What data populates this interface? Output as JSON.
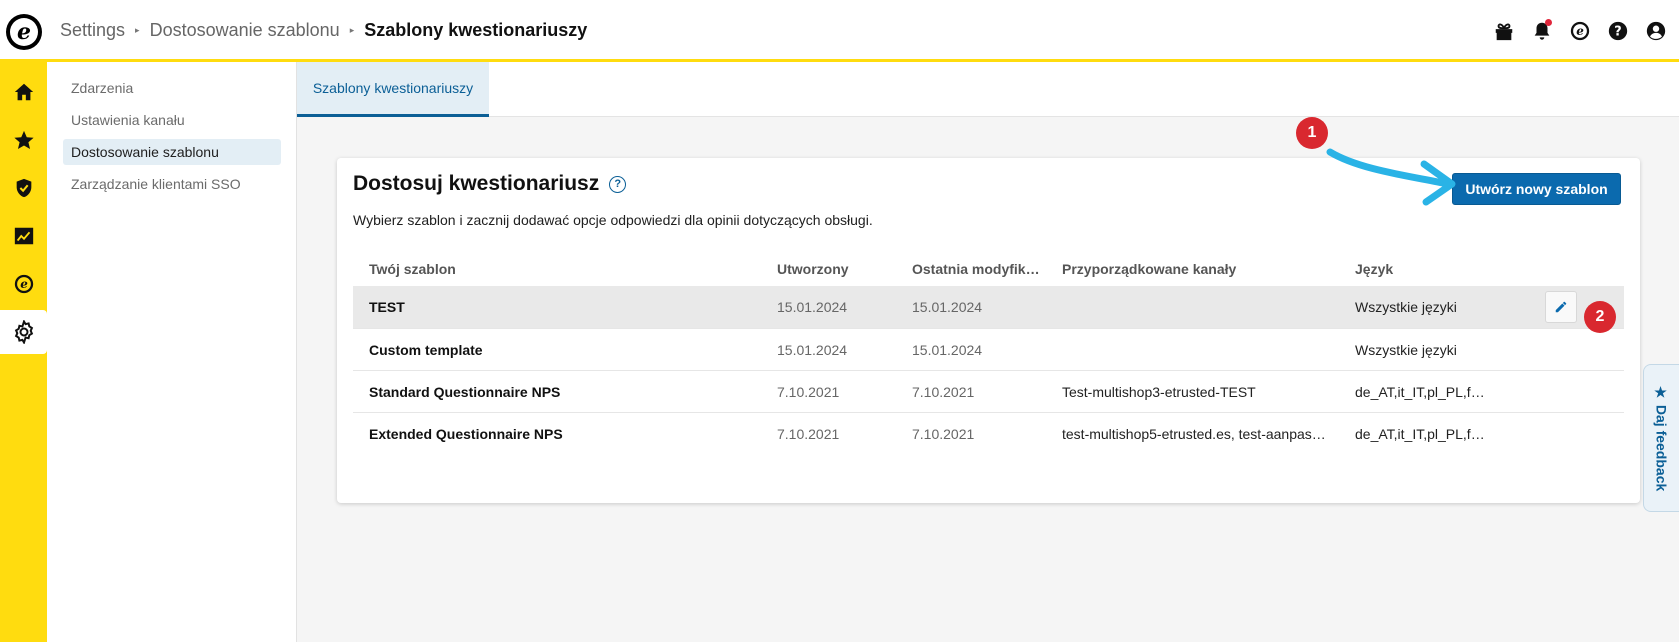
{
  "breadcrumb": {
    "items": [
      "Settings",
      "Dostosowanie szablonu"
    ],
    "current": "Szablony kwestionariuszy"
  },
  "subnav": {
    "items": [
      "Zdarzenia",
      "Ustawienia kanału",
      "Dostosowanie szablonu",
      "Zarządzanie klientami SSO"
    ],
    "active_index": 2
  },
  "tabs": [
    "Szablony kwestionariuszy"
  ],
  "card": {
    "title": "Dostosuj kwestionariusz",
    "help": "?",
    "description": "Wybierz szablon i zacznij dodawać opcje odpowiedzi dla opinii dotyczących obsługi.",
    "create_button": "Utwórz nowy szablon"
  },
  "table": {
    "headers": [
      "Twój szablon",
      "Utworzony",
      "Ostatnia modyfik…",
      "Przyporządkowane kanały",
      "Język"
    ],
    "rows": [
      [
        "TEST",
        "15.01.2024",
        "15.01.2024",
        "",
        "Wszystkie języki"
      ],
      [
        "Custom template",
        "15.01.2024",
        "15.01.2024",
        "",
        "Wszystkie języki"
      ],
      [
        "Standard Questionnaire NPS",
        "7.10.2021",
        "7.10.2021",
        "Test-multishop3-etrusted-TEST",
        "de_AT,it_IT,pl_PL,f…"
      ],
      [
        "Extended Questionnaire NPS",
        "7.10.2021",
        "7.10.2021",
        "test-multishop5-etrusted.es, test-aanpas…",
        "de_AT,it_IT,pl_PL,f…"
      ]
    ]
  },
  "annotations": {
    "badge1": "1",
    "badge2": "2"
  },
  "feedback": {
    "label": "★ Daj feedback"
  },
  "logo_letter": "e",
  "colors": {
    "brand_yellow": "#ffdc0f",
    "primary_blue": "#0b6aae",
    "badge_red": "#d9282f",
    "arrow_cyan": "#2ab3e6"
  }
}
